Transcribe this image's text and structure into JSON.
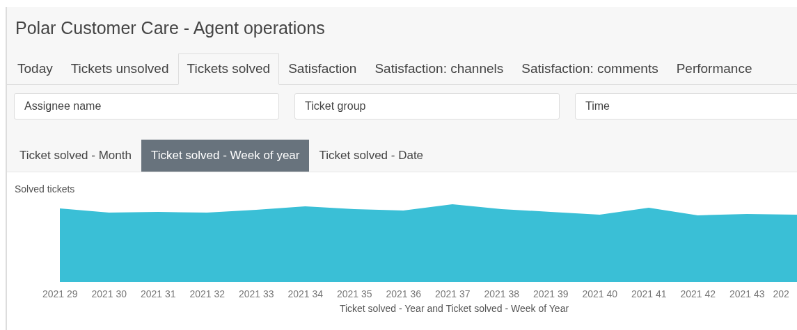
{
  "title": "Polar Customer Care - Agent operations",
  "tabs": [
    {
      "label": "Today",
      "selected": false
    },
    {
      "label": "Tickets unsolved",
      "selected": false
    },
    {
      "label": "Tickets solved",
      "selected": true
    },
    {
      "label": "Satisfaction",
      "selected": false
    },
    {
      "label": "Satisfaction: channels",
      "selected": false
    },
    {
      "label": "Satisfaction: comments",
      "selected": false
    },
    {
      "label": "Performance",
      "selected": false
    }
  ],
  "filters": [
    {
      "placeholder": "Assignee name"
    },
    {
      "placeholder": "Ticket group"
    },
    {
      "placeholder": "Time"
    }
  ],
  "chart_tabs": [
    {
      "label": "Ticket solved - Month",
      "selected": false
    },
    {
      "label": "Ticket solved - Week of year",
      "selected": true
    },
    {
      "label": "Ticket solved - Date",
      "selected": false
    }
  ],
  "chart": {
    "title": "Solved tickets",
    "x_labels": [
      "2021 29",
      "2021 30",
      "2021 31",
      "2021 32",
      "2021 33",
      "2021 34",
      "2021 35",
      "2021 36",
      "2021 37",
      "2021 38",
      "2021 39",
      "2021 40",
      "2021 41",
      "2021 42",
      "2021 43",
      "202"
    ],
    "xlabel": "Ticket solved - Year and Ticket solved - Week of Year"
  }
}
